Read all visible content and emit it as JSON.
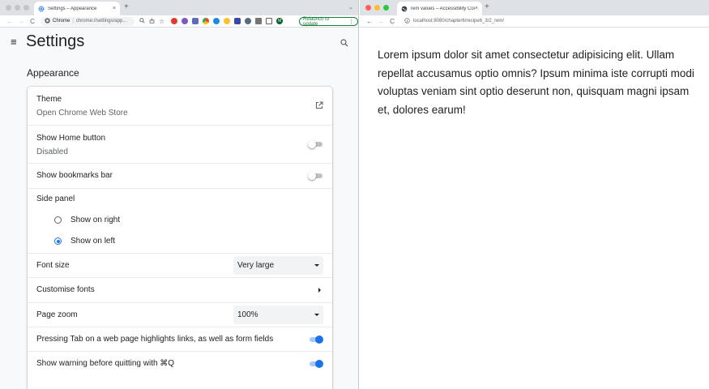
{
  "left_window": {
    "tab": {
      "title": "Settings – Appearance",
      "close": "×"
    },
    "new_tab": "+",
    "tab_menu": "⌄",
    "toolbar": {
      "back": "←",
      "forward": "→",
      "reload": "C",
      "chip": "Chrome",
      "separator": "|",
      "url": "chrome://settings/app...",
      "relaunch_label": "Relaunch to update",
      "menu": "⋮",
      "profile_initial": "M",
      "extensions": [
        "opera-icon",
        "ghost-icon",
        "chrome-icon",
        "theme-icon",
        "vpn-icon",
        "star-badge-icon",
        "wing-icon",
        "gear-icon",
        "puzzle-icon",
        "sidepanel-icon"
      ]
    },
    "settings": {
      "menu_icon": "≡",
      "title": "Settings",
      "section": "Appearance",
      "theme": {
        "label": "Theme",
        "sub": "Open Chrome Web Store"
      },
      "home_button": {
        "label": "Show Home button",
        "sub": "Disabled",
        "enabled": false
      },
      "bookmarks_bar": {
        "label": "Show bookmarks bar",
        "enabled": false
      },
      "side_panel": {
        "label": "Side panel",
        "options": [
          {
            "label": "Show on right",
            "selected": false
          },
          {
            "label": "Show on left",
            "selected": true
          }
        ]
      },
      "font_size": {
        "label": "Font size",
        "value": "Very large"
      },
      "customise_fonts": {
        "label": "Customise fonts"
      },
      "page_zoom": {
        "label": "Page zoom",
        "value": "100%"
      },
      "tab_highlights": {
        "label": "Pressing Tab on a web page highlights links, as well as form fields",
        "enabled": true
      },
      "quit_warning": {
        "label": "Show warning before quitting with ⌘Q",
        "enabled": true
      }
    }
  },
  "right_window": {
    "tab": {
      "title": "rem values – Accessibility Coo",
      "close": "×"
    },
    "new_tab": "+",
    "toolbar": {
      "back": "←",
      "forward": "→",
      "reload": "C",
      "url": "localhost:8080/chapter6/recipe6_3/2_rem/"
    },
    "body_text": "Lorem ipsum dolor sit amet consectetur adipisicing elit. Ullam repellat accusamus optio omnis? Ipsum minima iste corrupti modi voluptas veniam sint optio deserunt non, quisquam magni ipsam et, dolores earum!"
  },
  "colors": {
    "accent": "#1a73e8",
    "relaunch_green": "#188038",
    "traffic_inactive": "#c4c4c4",
    "traffic_red": "#ff5f57",
    "traffic_yellow": "#febc2e",
    "traffic_green": "#28c840"
  }
}
